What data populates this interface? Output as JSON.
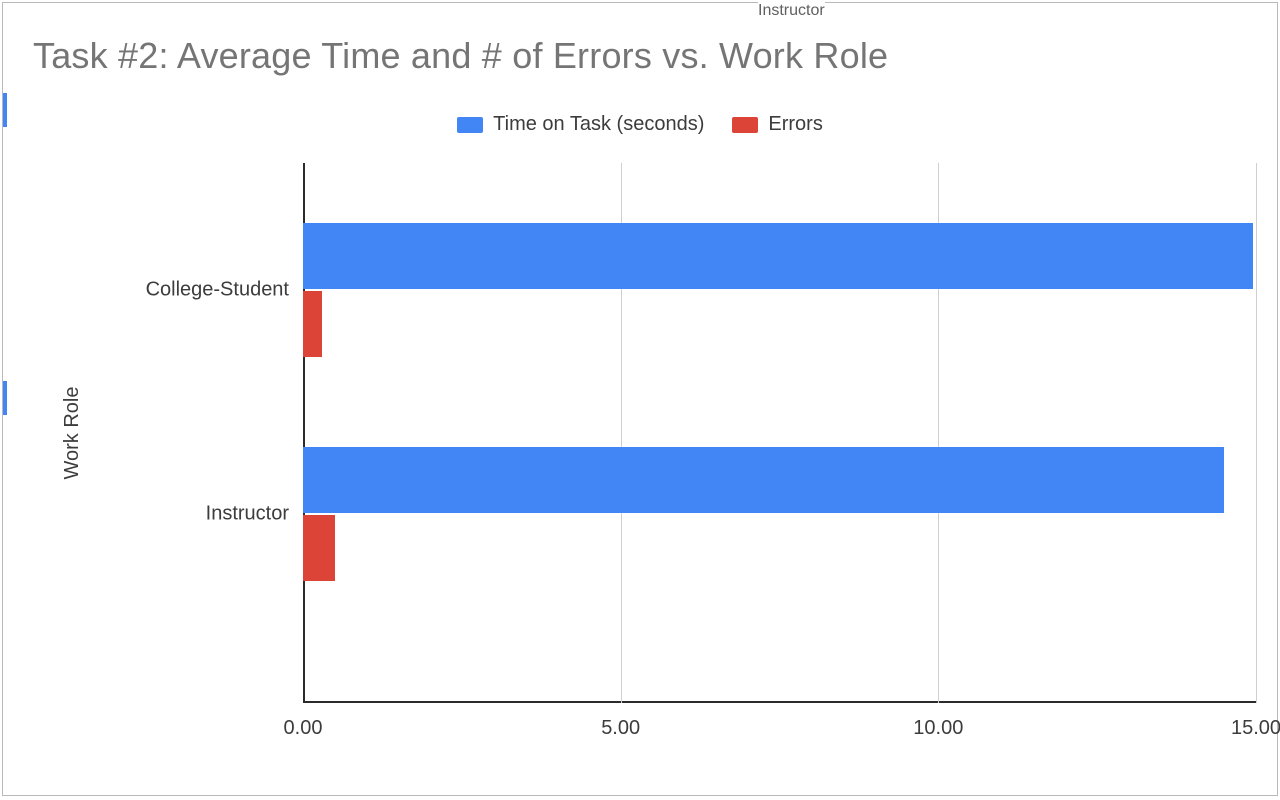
{
  "title": "Task #2: Average Time and # of Errors vs. Work Role",
  "legend": {
    "series1": "Time on Task (seconds)",
    "series2": "Errors"
  },
  "ylabel": "Work Role",
  "categories": {
    "c0": "College-Student",
    "c1": "Instructor"
  },
  "ticks": {
    "t0": "0.00",
    "t5": "5.00",
    "t10": "10.00",
    "t15": "15.00"
  },
  "crop_artifact_top": "Instructor",
  "chart_data": {
    "type": "bar",
    "orientation": "horizontal",
    "title": "Task #2: Average Time and # of Errors vs. Work Role",
    "xlabel": "",
    "ylabel": "Work Role",
    "xlim": [
      0,
      15
    ],
    "xticks": [
      0,
      5,
      10,
      15
    ],
    "categories": [
      "College-Student",
      "Instructor"
    ],
    "series": [
      {
        "name": "Time on Task (seconds)",
        "color": "#4285f4",
        "values": [
          14.95,
          14.5
        ]
      },
      {
        "name": "Errors",
        "color": "#db4437",
        "values": [
          0.3,
          0.5
        ]
      }
    ],
    "legend_position": "top",
    "grid": {
      "x": true,
      "y": false
    }
  }
}
